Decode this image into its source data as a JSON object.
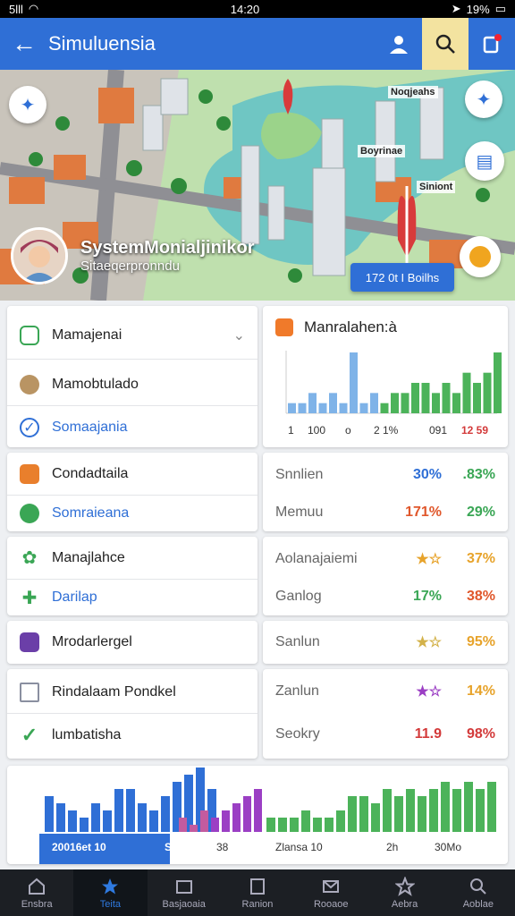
{
  "status": {
    "signal": "5lll",
    "time": "14:20",
    "battery": "19%"
  },
  "header": {
    "title": "Simuluensia"
  },
  "map": {
    "labels": [
      "Noqjeahs",
      "Boyrinae",
      "Siniont"
    ],
    "profile_name": "SystemMonialjinikor",
    "profile_sub": "Sitaeqerpronndu",
    "chip": "172 0t I Boilhs"
  },
  "menu": {
    "section1": {
      "header": "Mamajenai",
      "items": [
        "Mamobtulado",
        "Somaajania"
      ]
    },
    "section2": {
      "items": [
        "Condadtaila",
        "Somraieana"
      ]
    },
    "section3": {
      "items": [
        "Manajlahce",
        "Darilap"
      ]
    },
    "section4": {
      "items": [
        "Mrodarlergel"
      ]
    },
    "section5": {
      "items": [
        "Rindalaam Pondkel",
        "lumbatisha"
      ]
    }
  },
  "chart_card": {
    "title": "Manralahen:à",
    "axis": [
      "1",
      "100",
      "o",
      "2 1%",
      "091",
      "12 59"
    ]
  },
  "chart_data": [
    {
      "type": "bar",
      "title": "Manralahen:à",
      "series": [
        {
          "values": [
            1,
            1,
            2,
            1,
            2,
            1,
            6,
            1,
            2,
            1,
            2,
            2,
            3,
            3,
            2,
            3,
            2,
            4,
            3,
            4,
            6
          ]
        }
      ]
    },
    {
      "type": "bar",
      "series": [
        {
          "values": [
            5,
            4,
            3,
            2,
            4,
            3,
            6,
            6,
            4,
            3,
            5,
            7,
            8,
            9,
            6
          ]
        },
        {
          "values": [
            2,
            1,
            3,
            2,
            3,
            4,
            5,
            6
          ]
        },
        {
          "values": [
            2,
            2,
            2,
            3,
            2,
            2,
            3,
            5,
            5,
            4,
            6,
            5,
            6,
            5,
            6,
            7,
            6,
            7,
            6,
            7
          ]
        }
      ],
      "axis": [
        "20016et 10",
        "SIU",
        "38",
        "Zlansa 10",
        "2h",
        "30Mo"
      ]
    }
  ],
  "stats": [
    {
      "label": "Snnlien",
      "v1": "30%",
      "v2": ".83%",
      "c1": "#2f6fd6",
      "c2": "#3aa655"
    },
    {
      "label": "Memuu",
      "v1": "171%",
      "v2": "29%",
      "c1": "#e0572b",
      "c2": "#3aa655"
    },
    {
      "label": "Aolanajaiemi",
      "v1": "★☆",
      "v2": "37%",
      "c1": "#e7a32b",
      "c2": "#e7a32b"
    },
    {
      "label": "Ganlog",
      "v1": "17%",
      "v2": "38%",
      "c1": "#3aa655",
      "c2": "#e0572b"
    },
    {
      "label": "Sanlun",
      "v1": "★☆",
      "v2": "95%",
      "c1": "#d3b24a",
      "c2": "#e7a32b"
    },
    {
      "label": "Zanlun",
      "v1": "★☆",
      "v2": "14%",
      "c1": "#9b3fc4",
      "c2": "#e7a32b"
    },
    {
      "label": "Seokry",
      "v1": "11.9",
      "v2": "98%",
      "c1": "#d33a3a",
      "c2": "#d33a3a"
    }
  ],
  "tabs": [
    "Ensbra",
    "Teita",
    "Basjaoaia",
    "Ranion",
    "Rooaoe",
    "Aebra",
    "Aoblae"
  ]
}
